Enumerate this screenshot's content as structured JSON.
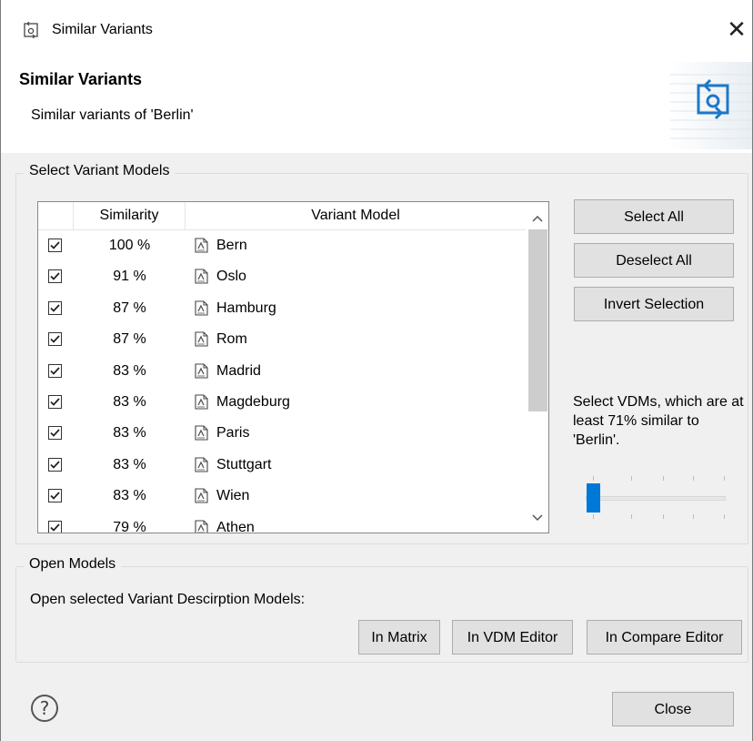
{
  "window": {
    "title": "Similar Variants",
    "close_glyph": "✕"
  },
  "header": {
    "title": "Similar Variants",
    "subtitle": "Similar variants of 'Berlin'"
  },
  "variants_group": {
    "legend": "Select Variant Models",
    "columns": [
      "",
      "Similarity",
      "Variant Model"
    ],
    "rows": [
      {
        "checked": true,
        "similarity": "100 %",
        "model": "Bern"
      },
      {
        "checked": true,
        "similarity": "91 %",
        "model": "Oslo"
      },
      {
        "checked": true,
        "similarity": "87 %",
        "model": "Hamburg"
      },
      {
        "checked": true,
        "similarity": "87 %",
        "model": "Rom"
      },
      {
        "checked": true,
        "similarity": "83 %",
        "model": "Madrid"
      },
      {
        "checked": true,
        "similarity": "83 %",
        "model": "Magdeburg"
      },
      {
        "checked": true,
        "similarity": "83 %",
        "model": "Paris"
      },
      {
        "checked": true,
        "similarity": "83 %",
        "model": "Stuttgart"
      },
      {
        "checked": true,
        "similarity": "83 %",
        "model": "Wien"
      },
      {
        "checked": true,
        "similarity": "79 %",
        "model": "Athen"
      }
    ],
    "buttons": {
      "select_all": "Select All",
      "deselect_all": "Deselect All",
      "invert": "Invert Selection"
    },
    "threshold_text": "Select VDMs, which are at least  71% similar to 'Berlin'.",
    "slider_value_fraction": 0.0
  },
  "open_group": {
    "legend": "Open Models",
    "label": "Open selected Variant Descirption Models:",
    "buttons": {
      "matrix": "In Matrix",
      "vdm_editor": "In VDM Editor",
      "compare_editor": "In Compare Editor"
    }
  },
  "footer": {
    "help": "?",
    "close": "Close"
  },
  "icons": {
    "title": "variant-compare-icon",
    "model": "variant-model-icon",
    "help": "help-icon"
  },
  "colors": {
    "accent": "#0078d7",
    "dialog_bg": "#f0f0f0",
    "header_art": "#0078d7"
  }
}
